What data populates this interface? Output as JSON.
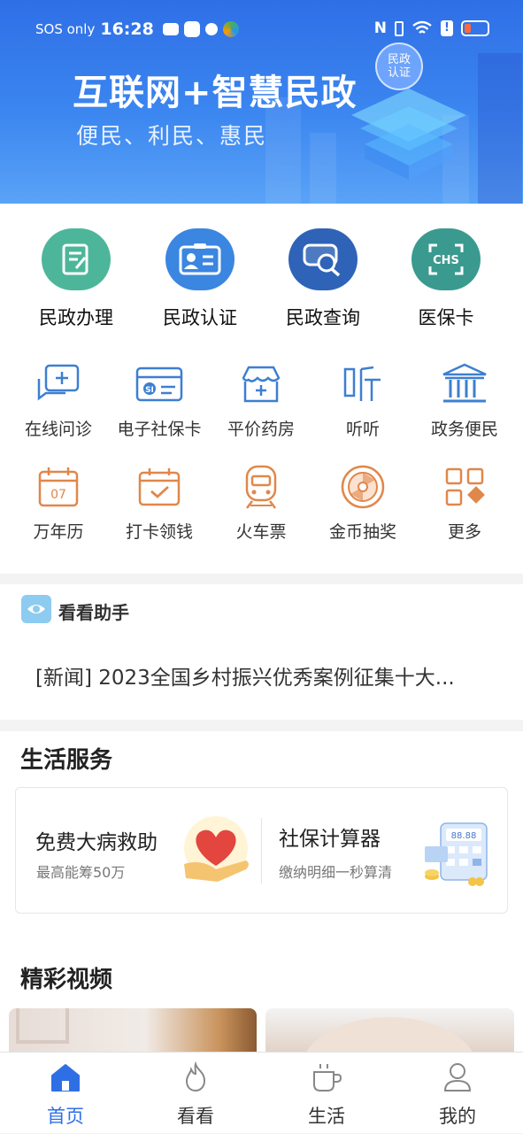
{
  "status_bar": {
    "carrier": "SOS only",
    "time": "16:28"
  },
  "hero": {
    "title": "互联网+智慧民政",
    "subtitle": "便民、利民、惠民",
    "badge": "民政\n认证"
  },
  "main_services": [
    {
      "label": "民政办理",
      "icon": "document-edit-icon",
      "color": "#4db69a"
    },
    {
      "label": "民政认证",
      "icon": "id-card-icon",
      "color": "#3a86e0"
    },
    {
      "label": "民政查询",
      "icon": "search-card-icon",
      "color": "#2f63b7"
    },
    {
      "label": "医保卡",
      "icon": "chs-icon",
      "color": "#3a9a8f"
    }
  ],
  "shortcuts_row1": [
    {
      "label": "在线问诊",
      "icon": "chat-plus-icon"
    },
    {
      "label": "电子社保卡",
      "icon": "social-card-icon"
    },
    {
      "label": "平价药房",
      "icon": "pharmacy-icon"
    },
    {
      "label": "听听",
      "icon": "listen-icon"
    },
    {
      "label": "政务便民",
      "icon": "government-building-icon"
    }
  ],
  "shortcuts_row2": [
    {
      "label": "万年历",
      "icon": "calendar-icon",
      "day": "07"
    },
    {
      "label": "打卡领钱",
      "icon": "check-in-icon"
    },
    {
      "label": "火车票",
      "icon": "train-icon"
    },
    {
      "label": "金币抽奖",
      "icon": "lottery-wheel-icon"
    },
    {
      "label": "更多",
      "icon": "more-grid-icon"
    }
  ],
  "assistant": {
    "title": "看看助手",
    "news": "[新闻] 2023全国乡村振兴优秀案例征集十大..."
  },
  "life_services": {
    "title": "生活服务",
    "cards": [
      {
        "title": "免费大病救助",
        "subtitle": "最高能筹50万",
        "icon": "heart-hand-icon"
      },
      {
        "title": "社保计算器",
        "subtitle": "缴纳明细一秒算清",
        "icon": "calculator-icon",
        "display": "88.88"
      }
    ]
  },
  "videos": {
    "title": "精彩视频"
  },
  "tabbar": [
    {
      "label": "首页",
      "icon": "home-icon",
      "active": true
    },
    {
      "label": "看看",
      "icon": "flame-icon",
      "active": false
    },
    {
      "label": "生活",
      "icon": "coffee-cup-icon",
      "active": false
    },
    {
      "label": "我的",
      "icon": "user-icon",
      "active": false
    }
  ],
  "colors": {
    "primary": "#2f6fe6",
    "icon_blue": "#3d7fd1",
    "icon_orange": "#e0874a"
  }
}
